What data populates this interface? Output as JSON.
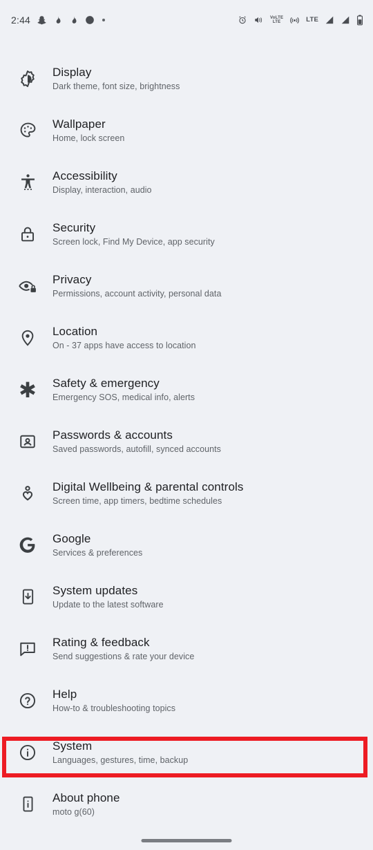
{
  "status_bar": {
    "time": "2:44",
    "left_icons": [
      {
        "name": "snapchat-notification-icon",
        "glyph": "snapchat"
      },
      {
        "name": "flame-notification-icon",
        "glyph": "flame"
      },
      {
        "name": "flame-notification-icon-2",
        "glyph": "flame"
      },
      {
        "name": "circle-notification-icon",
        "glyph": "circle"
      },
      {
        "name": "more-notifications-dot-icon",
        "glyph": "dot"
      }
    ],
    "right_icons": [
      {
        "name": "alarm-icon",
        "glyph": "alarm"
      },
      {
        "name": "vibrate-icon",
        "glyph": "vibrate"
      },
      {
        "name": "volte-icon",
        "label_top": "VoLTE",
        "label_bottom": "LTE"
      },
      {
        "name": "hotspot-icon",
        "glyph": "hotspot"
      },
      {
        "name": "lte-label-icon",
        "label": "LTE"
      },
      {
        "name": "signal-bars-sim1-icon",
        "glyph": "signal"
      },
      {
        "name": "signal-bars-sim2-icon",
        "glyph": "signal"
      },
      {
        "name": "battery-icon",
        "glyph": "battery"
      }
    ]
  },
  "colors": {
    "background": "#eff1f5",
    "title_text": "#202124",
    "subtitle_text": "#5f6368",
    "icon": "#3c4043",
    "highlight_border": "#ed1c24",
    "gesture_bar": "#7a7d82"
  },
  "settings": {
    "items": [
      {
        "icon": "brightness-icon",
        "title": "Display",
        "subtitle": "Dark theme, font size, brightness",
        "highlighted": false
      },
      {
        "icon": "palette-icon",
        "title": "Wallpaper",
        "subtitle": "Home, lock screen",
        "highlighted": false
      },
      {
        "icon": "accessibility-icon",
        "title": "Accessibility",
        "subtitle": "Display, interaction, audio",
        "highlighted": false
      },
      {
        "icon": "lock-icon",
        "title": "Security",
        "subtitle": "Screen lock, Find My Device, app security",
        "highlighted": false
      },
      {
        "icon": "eye-lock-icon",
        "title": "Privacy",
        "subtitle": "Permissions, account activity, personal data",
        "highlighted": false
      },
      {
        "icon": "location-pin-icon",
        "title": "Location",
        "subtitle": "On - 37 apps have access to location",
        "highlighted": false
      },
      {
        "icon": "asterisk-medical-icon",
        "title": "Safety & emergency",
        "subtitle": "Emergency SOS, medical info, alerts",
        "highlighted": false
      },
      {
        "icon": "account-card-icon",
        "title": "Passwords & accounts",
        "subtitle": "Saved passwords, autofill, synced accounts",
        "highlighted": false
      },
      {
        "icon": "wellbeing-person-icon",
        "title": "Digital Wellbeing & parental controls",
        "subtitle": "Screen time, app timers, bedtime schedules",
        "highlighted": false
      },
      {
        "icon": "google-g-icon",
        "title": "Google",
        "subtitle": "Services & preferences",
        "highlighted": false
      },
      {
        "icon": "phone-download-icon",
        "title": "System updates",
        "subtitle": "Update to the latest software",
        "highlighted": false
      },
      {
        "icon": "feedback-bubble-icon",
        "title": "Rating & feedback",
        "subtitle": "Send suggestions & rate your device",
        "highlighted": false
      },
      {
        "icon": "help-question-icon",
        "title": "Help",
        "subtitle": "How-to & troubleshooting topics",
        "highlighted": false
      },
      {
        "icon": "info-circle-icon",
        "title": "System",
        "subtitle": "Languages, gestures, time, backup",
        "highlighted": true
      },
      {
        "icon": "phone-info-icon",
        "title": "About phone",
        "subtitle": "moto g(60)",
        "highlighted": false
      }
    ]
  },
  "navigation": {
    "gesture_bar": "home-gesture-bar"
  }
}
